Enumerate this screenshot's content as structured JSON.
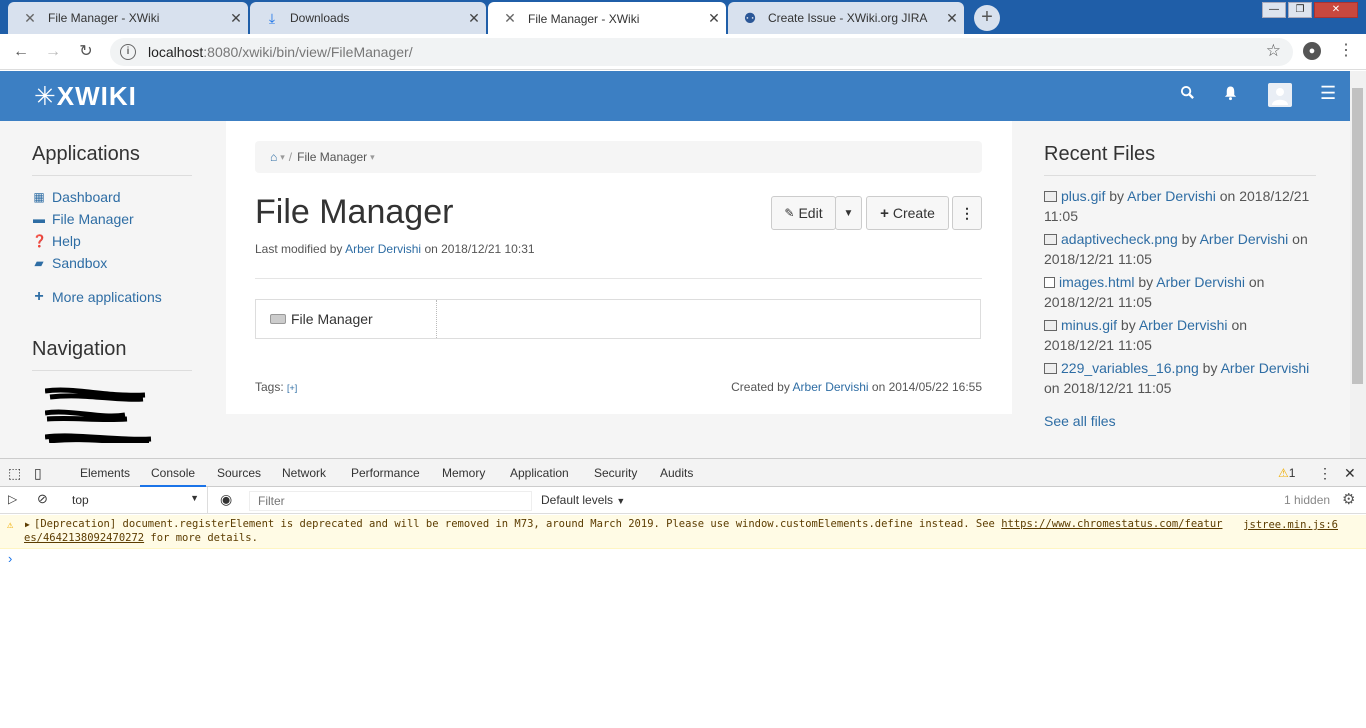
{
  "browser": {
    "tabs": [
      {
        "title": "File Manager - XWiki",
        "icon": "xwiki-icon",
        "active": false
      },
      {
        "title": "Downloads",
        "icon": "download-icon",
        "active": false
      },
      {
        "title": "File Manager - XWiki",
        "icon": "xwiki-icon",
        "active": true
      },
      {
        "title": "Create Issue - XWiki.org JIRA",
        "icon": "jira-icon",
        "active": false
      }
    ],
    "url_host": "localhost",
    "url_path": ":8080/xwiki/bin/view/FileManager/"
  },
  "header": {
    "logo": "XWIKI"
  },
  "left": {
    "applications_title": "Applications",
    "apps": [
      {
        "label": "Dashboard",
        "icon": "dashboard-icon"
      },
      {
        "label": "File Manager",
        "icon": "folder-icon"
      },
      {
        "label": "Help",
        "icon": "help-icon"
      },
      {
        "label": "Sandbox",
        "icon": "sandbox-icon"
      }
    ],
    "more_apps": "More applications",
    "navigation_title": "Navigation"
  },
  "main": {
    "breadcrumb_current": "File Manager",
    "title": "File Manager",
    "last_modified_prefix": "Last modified by",
    "last_modified_user": "Arber Dervishi",
    "last_modified_on": "on 2018/12/21 10:31",
    "edit_label": "Edit",
    "create_label": "Create",
    "tree_root": "File Manager",
    "tags_label": "Tags:",
    "tags_add": "[+]",
    "created_prefix": "Created by",
    "created_user": "Arber Dervishi",
    "created_on": "on 2014/05/22 16:55"
  },
  "right": {
    "title": "Recent Files",
    "files": [
      {
        "name": "plus.gif",
        "by": "by",
        "user": "Arber Dervishi",
        "date": "on 2018/12/21 11:05"
      },
      {
        "name": "adaptivecheck.png",
        "by": "by",
        "user": "Arber Dervishi",
        "date": "on 2018/12/21 11:05"
      },
      {
        "name": "images.html",
        "by": "by",
        "user": "Arber Dervishi",
        "date": "on 2018/12/21 11:05"
      },
      {
        "name": "minus.gif",
        "by": "by",
        "user": "Arber Dervishi",
        "date": "on 2018/12/21 11:05"
      },
      {
        "name": "229_variables_16.png",
        "by": "by",
        "user": "Arber Dervishi",
        "date": "on 2018/12/21 11:05"
      }
    ],
    "see_all": "See all files"
  },
  "devtools": {
    "tabs": [
      "Elements",
      "Console",
      "Sources",
      "Network",
      "Performance",
      "Memory",
      "Application",
      "Security",
      "Audits"
    ],
    "warn_count": "1",
    "context": "top",
    "filter_placeholder": "Filter",
    "levels": "Default levels",
    "hidden": "1 hidden",
    "message_text": "[Deprecation] document.registerElement is deprecated and will be removed in M73, around March 2019. Please use window.customElements.define instead. See ",
    "message_link": "https://www.chromestatus.com/features/4642138092470272",
    "message_suffix": " for more details.",
    "source": "jstree.min.js:6"
  }
}
